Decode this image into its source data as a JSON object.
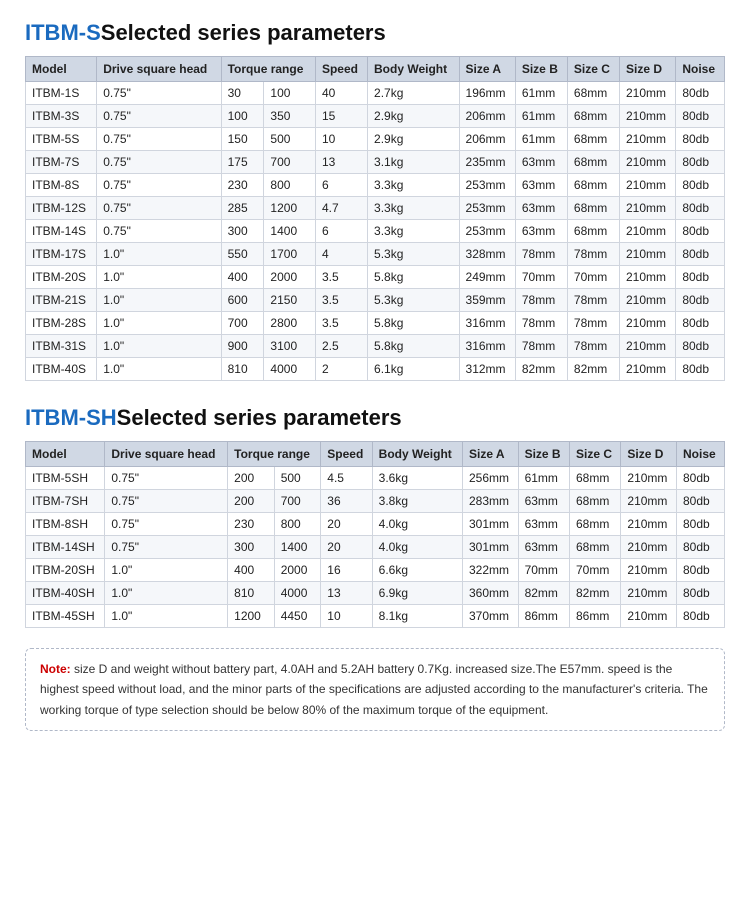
{
  "section1": {
    "title_highlight": "ITBM-S",
    "title_rest": "Selected series parameters",
    "headers": [
      "Model",
      "Drive square head",
      "Torque range",
      "",
      "Speed",
      "Body Weight",
      "Size A",
      "Size B",
      "Size C",
      "Size D",
      "Noise"
    ],
    "columns": [
      "Model",
      "Drive square head",
      "Torque range min",
      "Torque range max",
      "Speed",
      "Body Weight",
      "Size A",
      "Size B",
      "Size C",
      "Size D",
      "Noise"
    ],
    "rows": [
      [
        "ITBM-1S",
        "0.75\"",
        "30",
        "100",
        "40",
        "2.7kg",
        "196mm",
        "61mm",
        "68mm",
        "210mm",
        "80db"
      ],
      [
        "ITBM-3S",
        "0.75\"",
        "100",
        "350",
        "15",
        "2.9kg",
        "206mm",
        "61mm",
        "68mm",
        "210mm",
        "80db"
      ],
      [
        "ITBM-5S",
        "0.75\"",
        "150",
        "500",
        "10",
        "2.9kg",
        "206mm",
        "61mm",
        "68mm",
        "210mm",
        "80db"
      ],
      [
        "ITBM-7S",
        "0.75\"",
        "175",
        "700",
        "13",
        "3.1kg",
        "235mm",
        "63mm",
        "68mm",
        "210mm",
        "80db"
      ],
      [
        "ITBM-8S",
        "0.75\"",
        "230",
        "800",
        "6",
        "3.3kg",
        "253mm",
        "63mm",
        "68mm",
        "210mm",
        "80db"
      ],
      [
        "ITBM-12S",
        "0.75\"",
        "285",
        "1200",
        "4.7",
        "3.3kg",
        "253mm",
        "63mm",
        "68mm",
        "210mm",
        "80db"
      ],
      [
        "ITBM-14S",
        "0.75\"",
        "300",
        "1400",
        "6",
        "3.3kg",
        "253mm",
        "63mm",
        "68mm",
        "210mm",
        "80db"
      ],
      [
        "ITBM-17S",
        "1.0\"",
        "550",
        "1700",
        "4",
        "5.3kg",
        "328mm",
        "78mm",
        "78mm",
        "210mm",
        "80db"
      ],
      [
        "ITBM-20S",
        "1.0\"",
        "400",
        "2000",
        "3.5",
        "5.8kg",
        "249mm",
        "70mm",
        "70mm",
        "210mm",
        "80db"
      ],
      [
        "ITBM-21S",
        "1.0\"",
        "600",
        "2150",
        "3.5",
        "5.3kg",
        "359mm",
        "78mm",
        "78mm",
        "210mm",
        "80db"
      ],
      [
        "ITBM-28S",
        "1.0\"",
        "700",
        "2800",
        "3.5",
        "5.8kg",
        "316mm",
        "78mm",
        "78mm",
        "210mm",
        "80db"
      ],
      [
        "ITBM-31S",
        "1.0\"",
        "900",
        "3100",
        "2.5",
        "5.8kg",
        "316mm",
        "78mm",
        "78mm",
        "210mm",
        "80db"
      ],
      [
        "ITBM-40S",
        "1.0\"",
        "810",
        "4000",
        "2",
        "6.1kg",
        "312mm",
        "82mm",
        "82mm",
        "210mm",
        "80db"
      ]
    ]
  },
  "section2": {
    "title_highlight": "ITBM-SH",
    "title_rest": "Selected series parameters",
    "rows": [
      [
        "ITBM-5SH",
        "0.75\"",
        "200",
        "500",
        "4.5",
        "3.6kg",
        "256mm",
        "61mm",
        "68mm",
        "210mm",
        "80db"
      ],
      [
        "ITBM-7SH",
        "0.75\"",
        "200",
        "700",
        "36",
        "3.8kg",
        "283mm",
        "63mm",
        "68mm",
        "210mm",
        "80db"
      ],
      [
        "ITBM-8SH",
        "0.75\"",
        "230",
        "800",
        "20",
        "4.0kg",
        "301mm",
        "63mm",
        "68mm",
        "210mm",
        "80db"
      ],
      [
        "ITBM-14SH",
        "0.75\"",
        "300",
        "1400",
        "20",
        "4.0kg",
        "301mm",
        "63mm",
        "68mm",
        "210mm",
        "80db"
      ],
      [
        "ITBM-20SH",
        "1.0\"",
        "400",
        "2000",
        "16",
        "6.6kg",
        "322mm",
        "70mm",
        "70mm",
        "210mm",
        "80db"
      ],
      [
        "ITBM-40SH",
        "1.0\"",
        "810",
        "4000",
        "13",
        "6.9kg",
        "360mm",
        "82mm",
        "82mm",
        "210mm",
        "80db"
      ],
      [
        "ITBM-45SH",
        "1.0\"",
        "1200",
        "4450",
        "10",
        "8.1kg",
        "370mm",
        "86mm",
        "86mm",
        "210mm",
        "80db"
      ]
    ]
  },
  "note": {
    "label": "Note:",
    "text": " size D and weight without battery part, 4.0AH and 5.2AH battery 0.7Kg. increased size.The E57mm. speed is the highest speed without load, and the minor parts of the specifications are adjusted according to the manufacturer's criteria.\nThe working torque of type selection should be below 80% of the maximum torque of the equipment."
  },
  "table_headers": {
    "model": "Model",
    "drive": "Drive square head",
    "torque": "Torque range",
    "speed": "Speed",
    "weight": "Body Weight",
    "sizeA": "Size A",
    "sizeB": "Size B",
    "sizeC": "Size C",
    "sizeD": "Size D",
    "noise": "Noise"
  }
}
